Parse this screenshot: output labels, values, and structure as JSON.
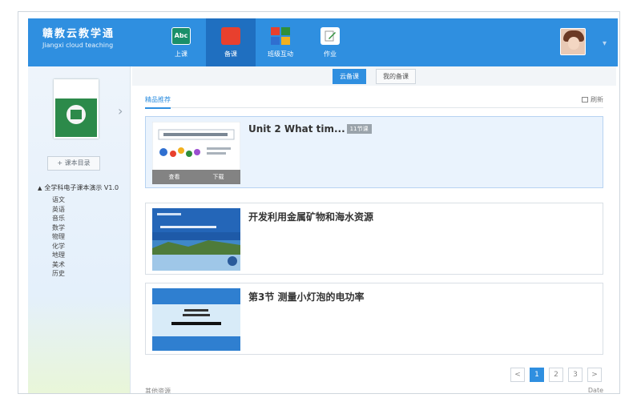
{
  "app": {
    "brand_zh": "赣教云教学通",
    "brand_en": "Jiangxi cloud teaching"
  },
  "nav": [
    {
      "label": "上课",
      "icon": "abc-icon",
      "icon_text": "Abc",
      "active": false
    },
    {
      "label": "备课",
      "icon": "book-icon",
      "active": true
    },
    {
      "label": "班级互动",
      "icon": "tiles-icon",
      "active": false
    },
    {
      "label": "作业",
      "icon": "pencil-icon",
      "active": false
    }
  ],
  "sidebar": {
    "catalog_button": "+ 课本目录",
    "tree_root": "全学科电子课本演示 V1.0",
    "subjects": [
      "语文",
      "英语",
      "音乐",
      "数学",
      "物理",
      "化学",
      "地理",
      "美术",
      "历史"
    ]
  },
  "main": {
    "top_tabs": [
      {
        "label": "云备课",
        "active": true
      },
      {
        "label": "我的备课",
        "active": false
      }
    ],
    "sub_tab": "精品推荐",
    "sub_right": "刷新",
    "courses": [
      {
        "title": "Unit 2 What tim...",
        "tag": "11节课",
        "selected": true,
        "overlay_left": "查看",
        "overlay_right": "下载"
      },
      {
        "title": "开发利用金属矿物和海水资源",
        "selected": false
      },
      {
        "title": "第3节 测量小灯泡的电功率",
        "selected": false
      }
    ],
    "pager": {
      "prev": "<",
      "pages": [
        "1",
        "2",
        "3"
      ],
      "next": ">",
      "current": "1"
    },
    "bottom_left": "其他资源",
    "bottom_right": "Date"
  },
  "colors": {
    "accent": "#2f8fe0",
    "header": "#2f8fe0",
    "selected_row": "#eaf3fd"
  }
}
